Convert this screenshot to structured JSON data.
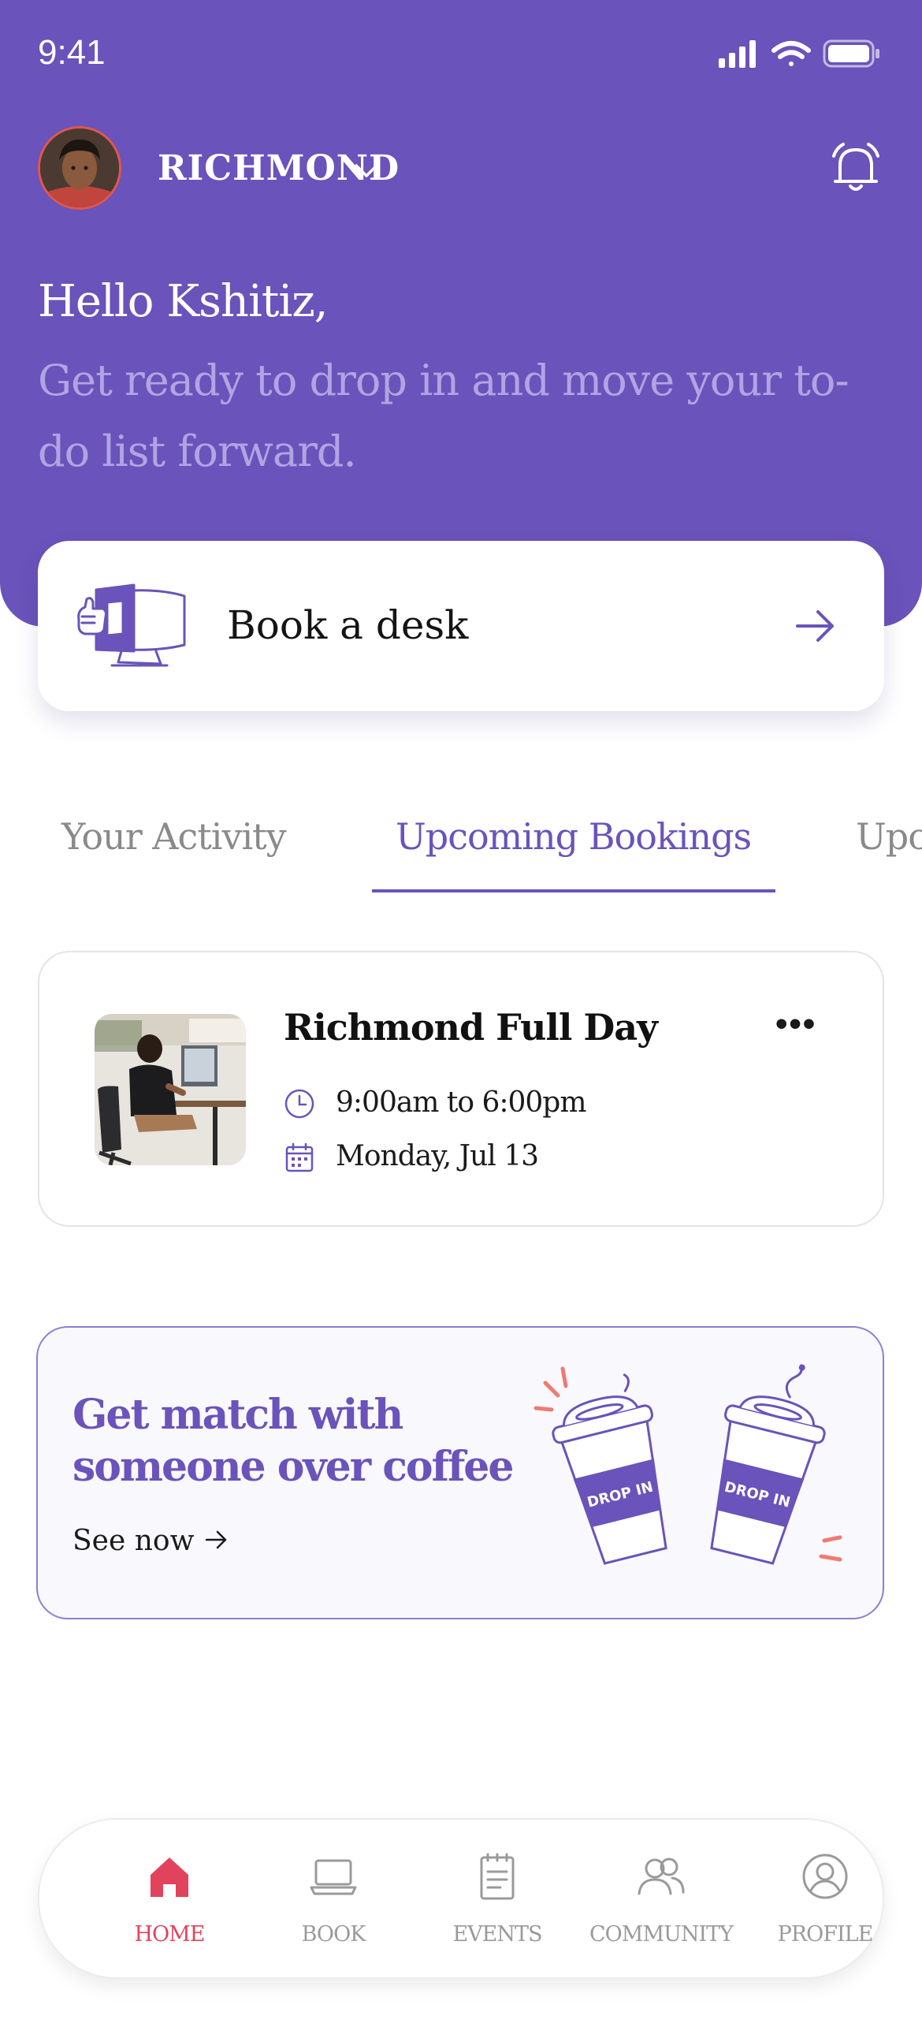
{
  "status_bar": {
    "time": "9:41",
    "icons": [
      "signal-icon",
      "wifi-icon",
      "battery-icon"
    ]
  },
  "header": {
    "location": "RICHMOND",
    "greeting": "Hello Kshitiz,",
    "subtitle": "Get ready to drop in and move your to-do list forward."
  },
  "book_card": {
    "label": "Book a desk"
  },
  "tabs": [
    {
      "label": "Your Activity",
      "active": false
    },
    {
      "label": "Upcoming Bookings",
      "active": true
    },
    {
      "label": "Upc",
      "active": false
    }
  ],
  "booking": {
    "title": "Richmond Full Day",
    "more": "•••",
    "time": "9:00am to 6:00pm",
    "date": "Monday, Jul 13"
  },
  "promo": {
    "title": "Get match with someone over coffee",
    "link": "See now",
    "cup_label_left": "DROP IN",
    "cup_label_right": "DROP IN"
  },
  "nav": [
    {
      "label": "HOME",
      "icon": "home-icon",
      "active": true
    },
    {
      "label": "BOOK",
      "icon": "laptop-icon",
      "active": false
    },
    {
      "label": "EVENTS",
      "icon": "notepad-icon",
      "active": false
    },
    {
      "label": "COMMUNITY",
      "icon": "users-icon",
      "active": false
    },
    {
      "label": "PROFILE",
      "icon": "user-circle-icon",
      "active": false
    }
  ],
  "colors": {
    "brand_purple": "#6a53ba",
    "subtitle_lavender": "#b1a4e3",
    "nav_active": "#e2435c",
    "nav_inactive": "#9a9a9a",
    "accent_coral": "#ee7b72"
  }
}
